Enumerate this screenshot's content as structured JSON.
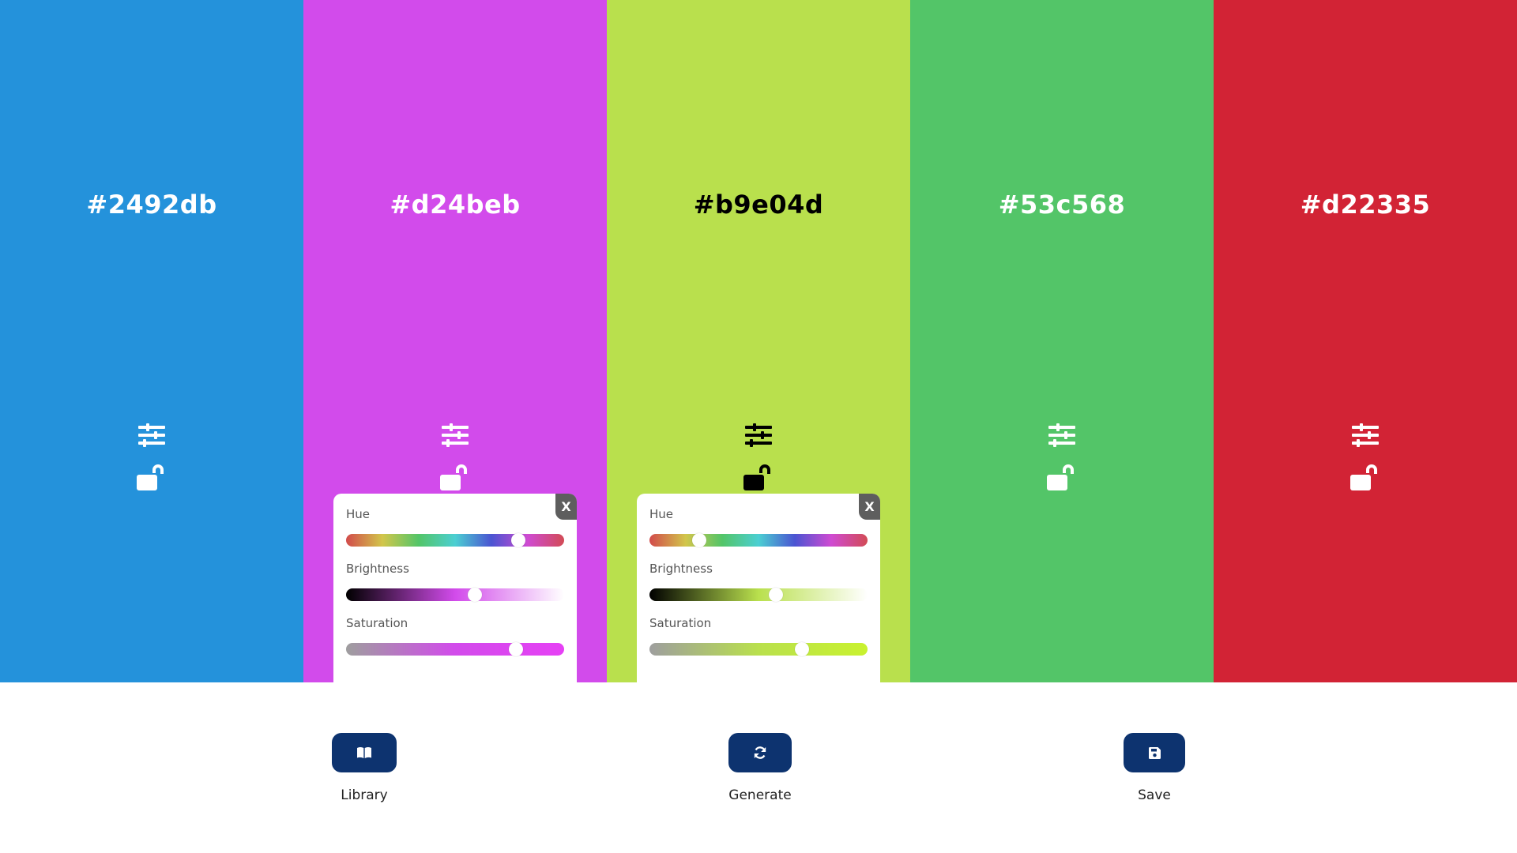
{
  "palette": {
    "colors": [
      {
        "hex": "#2492db",
        "text_color": "#ffffff",
        "adjust_icon": "sliders-icon",
        "lock_icon": "unlocked-icon",
        "lock_state": "unlocked"
      },
      {
        "hex": "#d24beb",
        "text_color": "#ffffff",
        "adjust_icon": "sliders-icon",
        "lock_icon": "unlocked-icon",
        "lock_state": "unlocked"
      },
      {
        "hex": "#b9e04d",
        "text_color": "#000000",
        "adjust_icon": "sliders-icon",
        "lock_icon": "unlocked-icon",
        "lock_state": "unlocked"
      },
      {
        "hex": "#53c568",
        "text_color": "#ffffff",
        "adjust_icon": "sliders-icon",
        "lock_icon": "unlocked-icon",
        "lock_state": "unlocked"
      },
      {
        "hex": "#d22335",
        "text_color": "#ffffff",
        "adjust_icon": "sliders-icon",
        "lock_icon": "unlocked-icon",
        "lock_state": "unlocked"
      }
    ]
  },
  "adjust_panels": [
    {
      "color_index": 1,
      "close_label": "X",
      "hue_label": "Hue",
      "brightness_label": "Brightness",
      "saturation_label": "Saturation",
      "hue_value": 0.79,
      "brightness_value": 0.59,
      "saturation_value": 0.78,
      "track_colors": {
        "brightness": [
          "#000000",
          "#d24beb",
          "#ffffff"
        ],
        "saturation": [
          "#9e9e9e",
          "#d24beb",
          "#e640f5"
        ]
      }
    },
    {
      "color_index": 2,
      "close_label": "X",
      "hue_label": "Hue",
      "brightness_label": "Brightness",
      "saturation_label": "Saturation",
      "hue_value": 0.23,
      "brightness_value": 0.58,
      "saturation_value": 0.7,
      "track_colors": {
        "brightness": [
          "#000000",
          "#b9e04d",
          "#ffffff"
        ],
        "saturation": [
          "#9e9e9e",
          "#b9e04d",
          "#c9f22f"
        ]
      }
    }
  ],
  "hue_track_colors": [
    "#d24b4b",
    "#d2c64b",
    "#53c568",
    "#4bcfd2",
    "#4b54d2",
    "#cf4bd2",
    "#d24b55"
  ],
  "footer": {
    "library": {
      "label": "Library",
      "icon": "book-icon"
    },
    "generate": {
      "label": "Generate",
      "icon": "refresh-icon"
    },
    "save": {
      "label": "Save",
      "icon": "floppy-disk-icon"
    }
  },
  "accent_color": "#0d336f"
}
